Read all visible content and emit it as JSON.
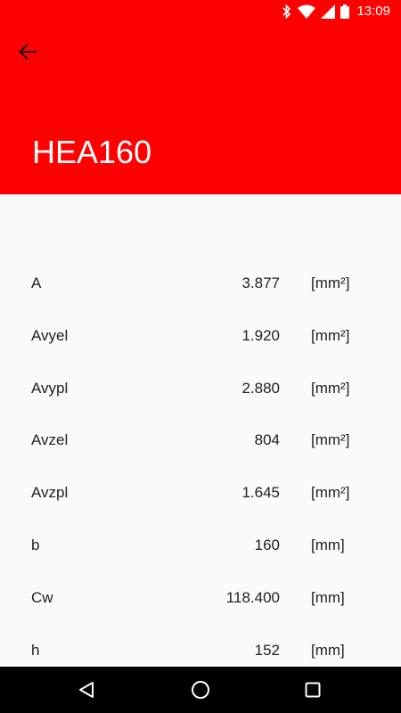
{
  "status_bar": {
    "time": "13:09",
    "icons": [
      "bluetooth-icon",
      "wifi-icon",
      "cell-signal-icon",
      "battery-icon"
    ],
    "background": "#ff0000"
  },
  "app_bar": {
    "title": "HEA160",
    "back_icon": "arrow-left-icon",
    "background": "#ff0000"
  },
  "properties": [
    {
      "name": "A",
      "value": "3.877",
      "unit": "[mm²]"
    },
    {
      "name": "Avyel",
      "value": "1.920",
      "unit": "[mm²]"
    },
    {
      "name": "Avypl",
      "value": "2.880",
      "unit": "[mm²]"
    },
    {
      "name": "Avzel",
      "value": "804",
      "unit": "[mm²]"
    },
    {
      "name": "Avzpl",
      "value": "1.645",
      "unit": "[mm²]"
    },
    {
      "name": "b",
      "value": "160",
      "unit": "[mm]"
    },
    {
      "name": "Cw",
      "value": "118.400",
      "unit": "[mm]"
    },
    {
      "name": "h",
      "value": "152",
      "unit": "[mm]"
    }
  ],
  "nav_bar": {
    "buttons": [
      "back-triangle-icon",
      "home-circle-icon",
      "recents-square-icon"
    ],
    "background": "#000000"
  }
}
